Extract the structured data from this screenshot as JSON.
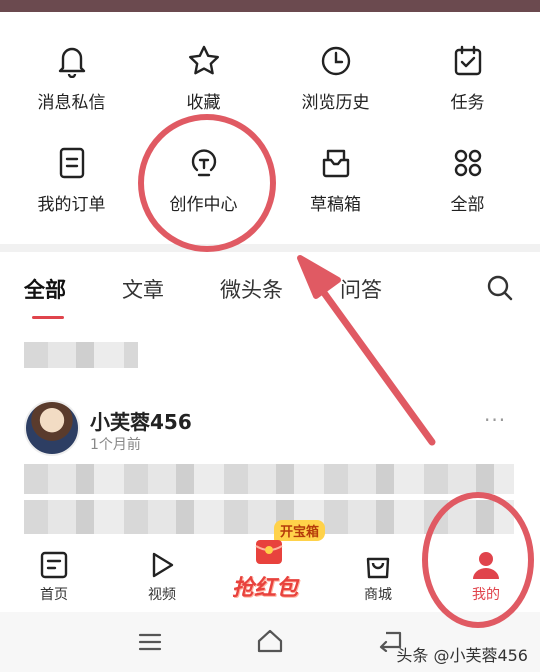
{
  "grid": [
    {
      "label": "消息私信",
      "icon": "bell-icon"
    },
    {
      "label": "收藏",
      "icon": "star-icon"
    },
    {
      "label": "浏览历史",
      "icon": "clock-icon"
    },
    {
      "label": "任务",
      "icon": "calendar-check-icon"
    },
    {
      "label": "我的订单",
      "icon": "order-icon"
    },
    {
      "label": "创作中心",
      "icon": "lightbulb-icon"
    },
    {
      "label": "草稿箱",
      "icon": "draft-box-icon"
    },
    {
      "label": "全部",
      "icon": "grid-icon"
    }
  ],
  "tabs": [
    "全部",
    "文章",
    "微头条",
    "问答"
  ],
  "post": {
    "author": "小芙蓉456",
    "time": "1个月前",
    "more": "···"
  },
  "promo": {
    "badge": "开宝箱",
    "label": "抢红包"
  },
  "nav": [
    {
      "label": "首页",
      "icon": "home-doc-icon"
    },
    {
      "label": "视频",
      "icon": "play-icon"
    },
    {
      "label": "商城",
      "icon": "shopping-bag-icon"
    },
    {
      "label": "我的",
      "icon": "person-icon"
    }
  ],
  "watermark": "头条 @小芙蓉456",
  "colors": {
    "accent": "#e0444c",
    "annotation": "#e05a63"
  }
}
